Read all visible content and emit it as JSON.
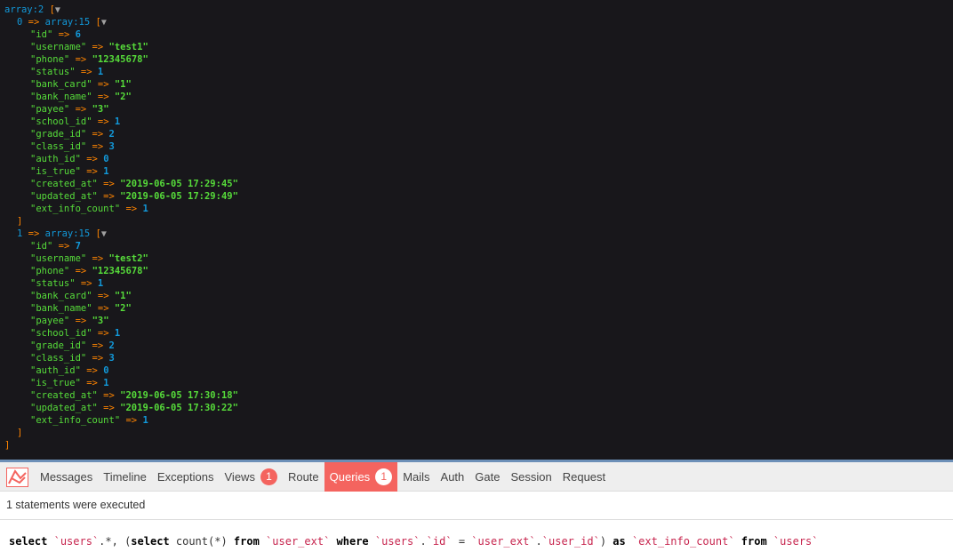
{
  "dump": {
    "root_type": "array:2",
    "items": [
      {
        "index": "0",
        "type": "array:15",
        "fields": [
          {
            "k": "id",
            "v": "6",
            "str": false
          },
          {
            "k": "username",
            "v": "test1",
            "str": true
          },
          {
            "k": "phone",
            "v": "12345678",
            "str": true
          },
          {
            "k": "status",
            "v": "1",
            "str": false
          },
          {
            "k": "bank_card",
            "v": "1",
            "str": true
          },
          {
            "k": "bank_name",
            "v": "2",
            "str": true
          },
          {
            "k": "payee",
            "v": "3",
            "str": true
          },
          {
            "k": "school_id",
            "v": "1",
            "str": false
          },
          {
            "k": "grade_id",
            "v": "2",
            "str": false
          },
          {
            "k": "class_id",
            "v": "3",
            "str": false
          },
          {
            "k": "auth_id",
            "v": "0",
            "str": false
          },
          {
            "k": "is_true",
            "v": "1",
            "str": false
          },
          {
            "k": "created_at",
            "v": "2019-06-05 17:29:45",
            "str": true
          },
          {
            "k": "updated_at",
            "v": "2019-06-05 17:29:49",
            "str": true
          },
          {
            "k": "ext_info_count",
            "v": "1",
            "str": false
          }
        ]
      },
      {
        "index": "1",
        "type": "array:15",
        "fields": [
          {
            "k": "id",
            "v": "7",
            "str": false
          },
          {
            "k": "username",
            "v": "test2",
            "str": true
          },
          {
            "k": "phone",
            "v": "12345678",
            "str": true
          },
          {
            "k": "status",
            "v": "1",
            "str": false
          },
          {
            "k": "bank_card",
            "v": "1",
            "str": true
          },
          {
            "k": "bank_name",
            "v": "2",
            "str": true
          },
          {
            "k": "payee",
            "v": "3",
            "str": true
          },
          {
            "k": "school_id",
            "v": "1",
            "str": false
          },
          {
            "k": "grade_id",
            "v": "2",
            "str": false
          },
          {
            "k": "class_id",
            "v": "3",
            "str": false
          },
          {
            "k": "auth_id",
            "v": "0",
            "str": false
          },
          {
            "k": "is_true",
            "v": "1",
            "str": false
          },
          {
            "k": "created_at",
            "v": "2019-06-05 17:30:18",
            "str": true
          },
          {
            "k": "updated_at",
            "v": "2019-06-05 17:30:22",
            "str": true
          },
          {
            "k": "ext_info_count",
            "v": "1",
            "str": false
          }
        ]
      }
    ]
  },
  "debugbar": {
    "logo_icon": "laravel-logo-icon",
    "tabs": [
      {
        "label": "Messages"
      },
      {
        "label": "Timeline"
      },
      {
        "label": "Exceptions"
      },
      {
        "label": "Views",
        "badge": "1"
      },
      {
        "label": "Route"
      },
      {
        "label": "Queries",
        "badge": "1",
        "active": true
      },
      {
        "label": "Mails"
      },
      {
        "label": "Auth"
      },
      {
        "label": "Gate"
      },
      {
        "label": "Session"
      },
      {
        "label": "Request"
      }
    ],
    "status_text": "1 statements were executed",
    "query_parts": [
      {
        "t": "select",
        "c": "kw"
      },
      {
        "t": " ",
        "c": ""
      },
      {
        "t": "`users`",
        "c": "tick"
      },
      {
        "t": ".*, (",
        "c": ""
      },
      {
        "t": "select",
        "c": "kw"
      },
      {
        "t": " count(*) ",
        "c": ""
      },
      {
        "t": "from",
        "c": "kw"
      },
      {
        "t": " ",
        "c": ""
      },
      {
        "t": "`user_ext`",
        "c": "tick"
      },
      {
        "t": " ",
        "c": ""
      },
      {
        "t": "where",
        "c": "kw"
      },
      {
        "t": " ",
        "c": ""
      },
      {
        "t": "`users`",
        "c": "tick"
      },
      {
        "t": ".",
        "c": ""
      },
      {
        "t": "`id`",
        "c": "tick"
      },
      {
        "t": " = ",
        "c": ""
      },
      {
        "t": "`user_ext`",
        "c": "tick"
      },
      {
        "t": ".",
        "c": ""
      },
      {
        "t": "`user_id`",
        "c": "tick"
      },
      {
        "t": ") ",
        "c": ""
      },
      {
        "t": "as",
        "c": "kw"
      },
      {
        "t": " ",
        "c": ""
      },
      {
        "t": "`ext_info_count`",
        "c": "tick"
      },
      {
        "t": " ",
        "c": ""
      },
      {
        "t": "from",
        "c": "kw"
      },
      {
        "t": " ",
        "c": ""
      },
      {
        "t": "`users`",
        "c": "tick"
      }
    ]
  },
  "colors": {
    "dump_bg": "#18171b",
    "accent": "#f4645f",
    "key_green": "#56db3a",
    "type_blue": "#1299da",
    "operator_orange": "#ff8400"
  }
}
